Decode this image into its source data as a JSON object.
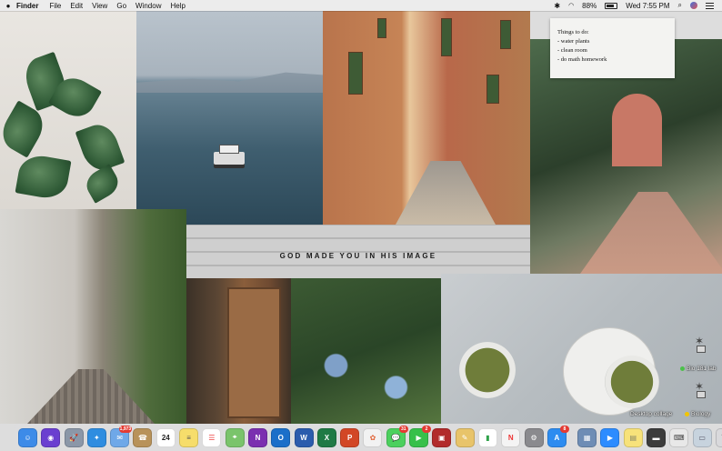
{
  "menubar": {
    "app_name": "Finder",
    "items": [
      "File",
      "Edit",
      "View",
      "Go",
      "Window",
      "Help"
    ],
    "battery": "88%",
    "clock": "Wed 7:55 PM"
  },
  "note": {
    "title": "Things to do:",
    "items": [
      "- water plants",
      "- clean room",
      "- do math homework"
    ]
  },
  "collage": {
    "quote": "GOD MADE YOU IN HIS IMAGE"
  },
  "desktop": {
    "items": [
      {
        "label": "Bio 181 lab",
        "tag_color": "#4cc04a"
      },
      {
        "label": "Desktop collage"
      },
      {
        "label": "Biology",
        "tag_color": "#f2c500"
      }
    ]
  },
  "dock": {
    "apps": [
      {
        "name": "finder-icon",
        "color": "#3d8be8",
        "glyph": "☺"
      },
      {
        "name": "siri-icon",
        "color": "#6a3fd0",
        "glyph": "◉"
      },
      {
        "name": "launchpad-icon",
        "color": "#8b97a8",
        "glyph": "🚀"
      },
      {
        "name": "safari-icon",
        "color": "#2f8de0",
        "glyph": "✦"
      },
      {
        "name": "mail-icon",
        "color": "#6fa8e8",
        "glyph": "✉",
        "badge": "1,973"
      },
      {
        "name": "contacts-icon",
        "color": "#b8925a",
        "glyph": "☎"
      },
      {
        "name": "calendar-icon",
        "color": "#ffffff",
        "glyph": "24",
        "text_color": "#222"
      },
      {
        "name": "notes-icon",
        "color": "#f6dd6b",
        "glyph": "≡",
        "text_color": "#555"
      },
      {
        "name": "reminders-icon",
        "color": "#ffffff",
        "glyph": "☰",
        "text_color": "#e44"
      },
      {
        "name": "maps-icon",
        "color": "#7ac46b",
        "glyph": "⌖"
      },
      {
        "name": "onenote-icon",
        "color": "#7b2fb0",
        "glyph": "N"
      },
      {
        "name": "outlook-icon",
        "color": "#1b6fc9",
        "glyph": "O"
      },
      {
        "name": "word-icon",
        "color": "#2b5cad",
        "glyph": "W"
      },
      {
        "name": "excel-icon",
        "color": "#1f7a45",
        "glyph": "X"
      },
      {
        "name": "powerpoint-icon",
        "color": "#d24726",
        "glyph": "P"
      },
      {
        "name": "photos-icon",
        "color": "#f2f2f2",
        "glyph": "✿",
        "text_color": "#e2663a"
      },
      {
        "name": "messages-icon",
        "color": "#4cd05e",
        "glyph": "💬",
        "badge": "31"
      },
      {
        "name": "facetime-icon",
        "color": "#37c04a",
        "glyph": "▶",
        "badge": "2"
      },
      {
        "name": "photo-booth-icon",
        "color": "#b22b2b",
        "glyph": "▣"
      },
      {
        "name": "preview-icon",
        "color": "#e8c46a",
        "glyph": "✎"
      },
      {
        "name": "numbers-icon",
        "color": "#ffffff",
        "glyph": "▮",
        "text_color": "#2fa24a"
      },
      {
        "name": "news-icon",
        "color": "#f4f4f4",
        "glyph": "N",
        "text_color": "#e33"
      },
      {
        "name": "system-preferences-icon",
        "color": "#8a8a8e",
        "glyph": "⚙"
      },
      {
        "name": "app-store-icon",
        "color": "#2d8cf0",
        "glyph": "A",
        "badge": "8"
      }
    ],
    "right_apps": [
      {
        "name": "image-capture-icon",
        "color": "#6e8db5",
        "glyph": "▦"
      },
      {
        "name": "zoom-icon",
        "color": "#2d8cff",
        "glyph": "▶"
      },
      {
        "name": "stickies-icon",
        "color": "#f7e27a",
        "glyph": "▤",
        "text_color": "#886"
      },
      {
        "name": "keyboard-viewer-icon",
        "color": "#3c3c3c",
        "glyph": "▬"
      },
      {
        "name": "downloads-folder-icon",
        "color": "#e8e8e8",
        "glyph": "⌨",
        "text_color": "#444"
      },
      {
        "name": "documents-folder-icon",
        "color": "#c7d3de",
        "glyph": "▭",
        "text_color": "#556"
      },
      {
        "name": "trash-icon",
        "color": "#d9d9dc",
        "glyph": "🗑",
        "text_color": "#444"
      }
    ]
  }
}
